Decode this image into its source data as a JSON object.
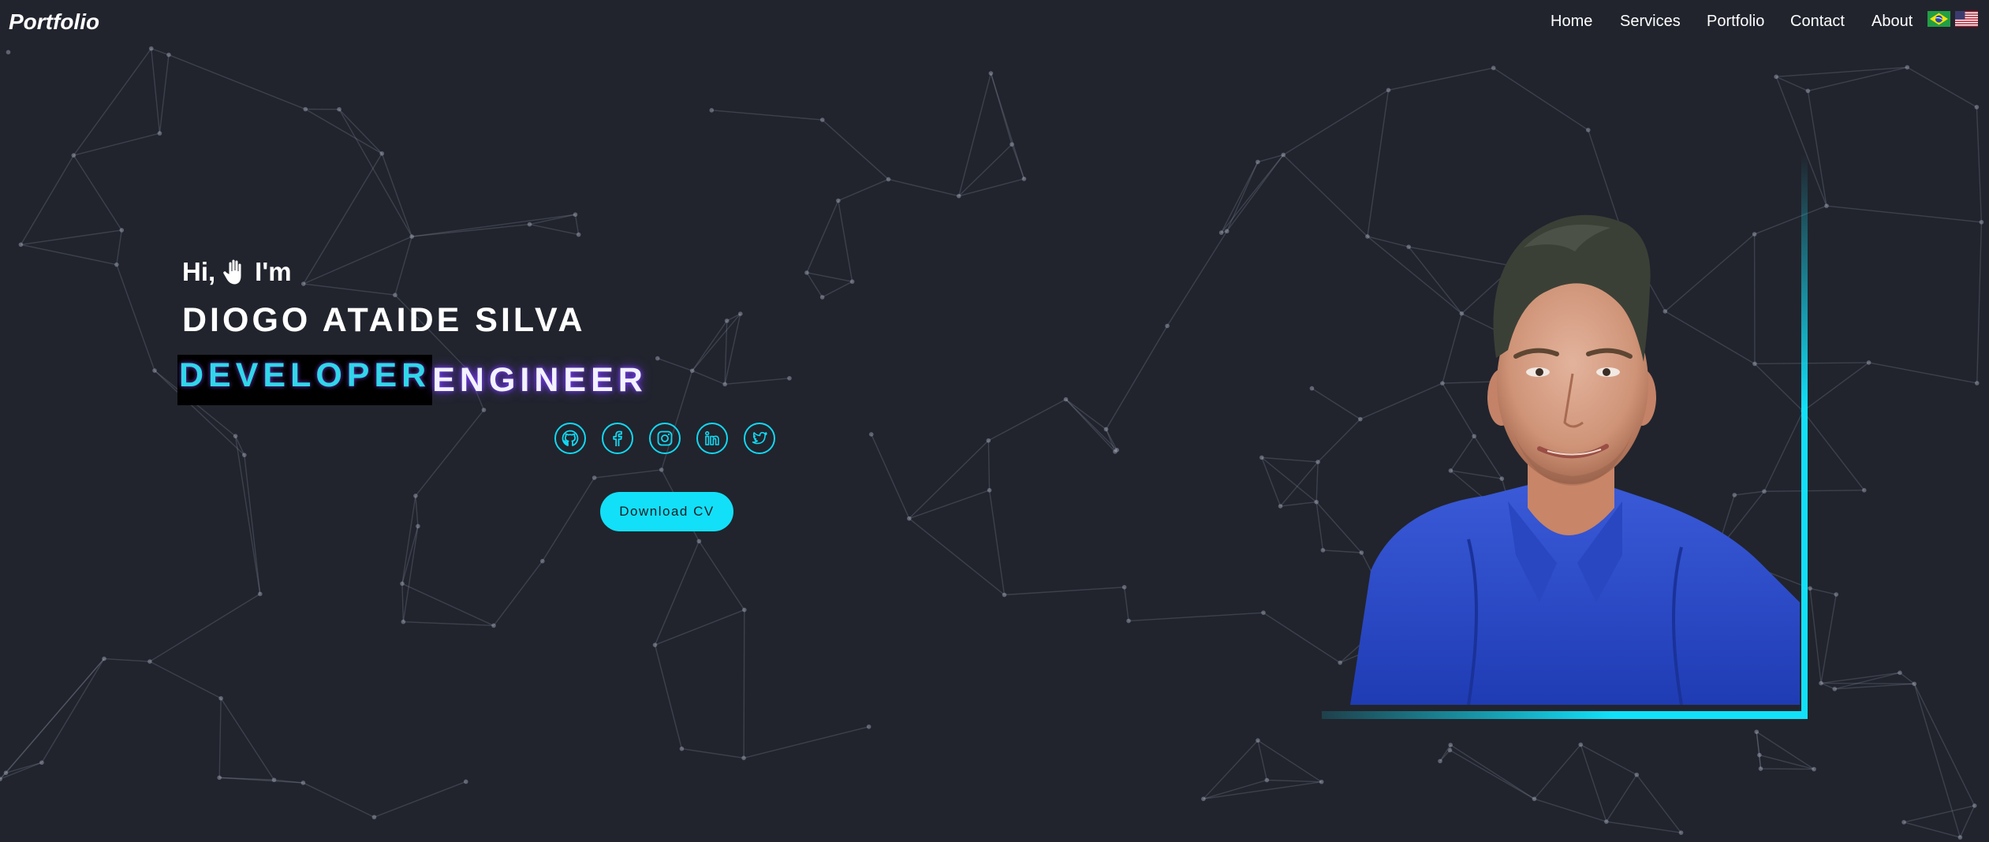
{
  "header": {
    "brand": "Portfolio",
    "nav": [
      "Home",
      "Services",
      "Portfolio",
      "Contact",
      "About"
    ],
    "languages": [
      "Brazil flag",
      "United States flag"
    ]
  },
  "hero": {
    "greeting_hi": "Hi,",
    "greeting_im": "I'm",
    "name": "DIOGO ATAIDE SILVA",
    "role_primary": "DEVELOPER",
    "role_secondary": "ENGINEER",
    "social_icons": [
      "github-icon",
      "facebook-icon",
      "instagram-icon",
      "linkedin-icon",
      "twitter-icon"
    ],
    "download_label": "Download CV"
  },
  "colors": {
    "background": "#21242d",
    "accent": "#12e0f8",
    "glow": "#7b3cff"
  }
}
